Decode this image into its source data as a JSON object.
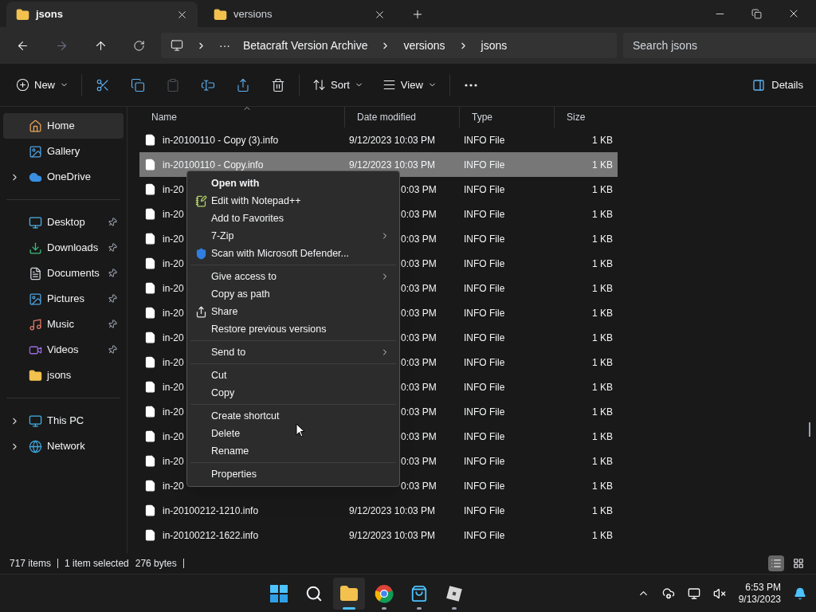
{
  "tabs": [
    {
      "label": "jsons",
      "selected": true
    },
    {
      "label": "versions",
      "selected": false
    }
  ],
  "address": {
    "more": "···",
    "crumbs": [
      "Betacraft Version Archive",
      "versions",
      "jsons"
    ]
  },
  "search": {
    "placeholder": "Search jsons"
  },
  "toolbar": {
    "buttons": [
      {
        "kind": "new",
        "label": "New",
        "disabled": false
      },
      {
        "kind": "cut",
        "disabled": false
      },
      {
        "kind": "copy",
        "disabled": false
      },
      {
        "kind": "paste",
        "disabled": true
      },
      {
        "kind": "rename",
        "disabled": false
      },
      {
        "kind": "share",
        "disabled": false
      },
      {
        "kind": "delete",
        "disabled": false
      },
      {
        "kind": "sort",
        "label": "Sort",
        "disabled": false
      },
      {
        "kind": "view",
        "label": "View",
        "disabled": false
      },
      {
        "kind": "more",
        "disabled": false
      }
    ],
    "details": "Details"
  },
  "sidebar": {
    "groups": [
      [
        {
          "kind": "home",
          "label": "Home",
          "selected": true,
          "expandable": false,
          "pinned": false
        },
        {
          "kind": "gallery",
          "label": "Gallery",
          "selected": false,
          "expandable": false,
          "pinned": false
        },
        {
          "kind": "cloud",
          "label": "OneDrive",
          "selected": false,
          "expandable": true,
          "pinned": false
        }
      ],
      [
        {
          "kind": "desktop",
          "label": "Desktop",
          "selected": false,
          "expandable": false,
          "pinned": true
        },
        {
          "kind": "downloads",
          "label": "Downloads",
          "selected": false,
          "expandable": false,
          "pinned": true
        },
        {
          "kind": "documents",
          "label": "Documents",
          "selected": false,
          "expandable": false,
          "pinned": true
        },
        {
          "kind": "pictures",
          "label": "Pictures",
          "selected": false,
          "expandable": false,
          "pinned": true
        },
        {
          "kind": "music",
          "label": "Music",
          "selected": false,
          "expandable": false,
          "pinned": true
        },
        {
          "kind": "videos",
          "label": "Videos",
          "selected": false,
          "expandable": false,
          "pinned": true
        },
        {
          "kind": "folder",
          "label": "jsons",
          "selected": false,
          "expandable": false,
          "pinned": false
        }
      ],
      [
        {
          "kind": "pc",
          "label": "This PC",
          "selected": false,
          "expandable": true,
          "pinned": false
        },
        {
          "kind": "network",
          "label": "Network",
          "selected": false,
          "expandable": true,
          "pinned": false
        }
      ]
    ]
  },
  "table": {
    "columns": [
      {
        "label": "Name",
        "sorted": true
      },
      {
        "label": "Date modified",
        "sorted": false
      },
      {
        "label": "Type",
        "sorted": false
      },
      {
        "label": "Size",
        "sorted": false
      }
    ],
    "rows": [
      {
        "name": "in-20100110 - Copy (3).info",
        "date": "9/12/2023 10:03 PM",
        "type": "INFO File",
        "size": "1 KB",
        "selected": false,
        "covered": false
      },
      {
        "name": "in-20100110 - Copy.info",
        "date": "9/12/2023 10:03 PM",
        "type": "INFO File",
        "size": "1 KB",
        "selected": true,
        "covered": false
      },
      {
        "name": "in-20",
        "date": "0:03 PM",
        "type": "INFO File",
        "size": "1 KB",
        "selected": false,
        "covered": true
      },
      {
        "name": "in-20",
        "date": "0:03 PM",
        "type": "INFO File",
        "size": "1 KB",
        "selected": false,
        "covered": true
      },
      {
        "name": "in-20",
        "date": "0:03 PM",
        "type": "INFO File",
        "size": "1 KB",
        "selected": false,
        "covered": true
      },
      {
        "name": "in-20",
        "date": "0:03 PM",
        "type": "INFO File",
        "size": "1 KB",
        "selected": false,
        "covered": true
      },
      {
        "name": "in-20",
        "date": "0:03 PM",
        "type": "INFO File",
        "size": "1 KB",
        "selected": false,
        "covered": true
      },
      {
        "name": "in-20",
        "date": "0:03 PM",
        "type": "INFO File",
        "size": "1 KB",
        "selected": false,
        "covered": true
      },
      {
        "name": "in-20",
        "date": "0:03 PM",
        "type": "INFO File",
        "size": "1 KB",
        "selected": false,
        "covered": true
      },
      {
        "name": "in-20",
        "date": "0:03 PM",
        "type": "INFO File",
        "size": "1 KB",
        "selected": false,
        "covered": true
      },
      {
        "name": "in-20",
        "date": "0:03 PM",
        "type": "INFO File",
        "size": "1 KB",
        "selected": false,
        "covered": true
      },
      {
        "name": "in-20",
        "date": "0:03 PM",
        "type": "INFO File",
        "size": "1 KB",
        "selected": false,
        "covered": true
      },
      {
        "name": "in-20",
        "date": "0:03 PM",
        "type": "INFO File",
        "size": "1 KB",
        "selected": false,
        "covered": true
      },
      {
        "name": "in-20",
        "date": "0:03 PM",
        "type": "INFO File",
        "size": "1 KB",
        "selected": false,
        "covered": true
      },
      {
        "name": "in-20",
        "date": "0:03 PM",
        "type": "INFO File",
        "size": "1 KB",
        "selected": false,
        "covered": true
      },
      {
        "name": "in-20100212-1210.info",
        "date": "9/12/2023 10:03 PM",
        "type": "INFO File",
        "size": "1 KB",
        "selected": false,
        "covered": false
      },
      {
        "name": "in-20100212-1622.info",
        "date": "9/12/2023 10:03 PM",
        "type": "INFO File",
        "size": "1 KB",
        "selected": false,
        "covered": false
      }
    ]
  },
  "context_menu": {
    "groups": [
      [
        {
          "label": "Open with",
          "bold": true,
          "submenu": false,
          "kind": "plain"
        },
        {
          "label": "Edit with Notepad++",
          "bold": false,
          "submenu": false,
          "kind": "notepad"
        },
        {
          "label": "Add to Favorites",
          "bold": false,
          "submenu": false,
          "kind": "plain"
        },
        {
          "label": "7-Zip",
          "bold": false,
          "submenu": true,
          "kind": "plain"
        },
        {
          "label": "Scan with Microsoft Defender...",
          "bold": false,
          "submenu": false,
          "kind": "shield"
        }
      ],
      [
        {
          "label": "Give access to",
          "bold": false,
          "submenu": true,
          "kind": "plain"
        },
        {
          "label": "Copy as path",
          "bold": false,
          "submenu": false,
          "kind": "plain"
        },
        {
          "label": "Share",
          "bold": false,
          "submenu": false,
          "kind": "share"
        },
        {
          "label": "Restore previous versions",
          "bold": false,
          "submenu": false,
          "kind": "plain"
        }
      ],
      [
        {
          "label": "Send to",
          "bold": false,
          "submenu": true,
          "kind": "plain"
        }
      ],
      [
        {
          "label": "Cut",
          "bold": false,
          "submenu": false,
          "kind": "plain"
        },
        {
          "label": "Copy",
          "bold": false,
          "submenu": false,
          "kind": "plain"
        }
      ],
      [
        {
          "label": "Create shortcut",
          "bold": false,
          "submenu": false,
          "kind": "plain"
        },
        {
          "label": "Delete",
          "bold": false,
          "submenu": false,
          "kind": "plain"
        },
        {
          "label": "Rename",
          "bold": false,
          "submenu": false,
          "kind": "plain"
        }
      ],
      [
        {
          "label": "Properties",
          "bold": false,
          "submenu": false,
          "kind": "plain"
        }
      ]
    ]
  },
  "status_bar": {
    "count": "717 items",
    "selection": "1 item selected",
    "size": "276 bytes",
    "views": [
      {
        "kind": "details",
        "selected": true
      },
      {
        "kind": "tiles",
        "selected": false
      }
    ]
  },
  "taskbar": {
    "apps": [
      {
        "kind": "start",
        "active": false,
        "running": false
      },
      {
        "kind": "search",
        "active": false,
        "running": false
      },
      {
        "kind": "explorer",
        "active": true,
        "running": true
      },
      {
        "kind": "chrome",
        "active": false,
        "running": true
      },
      {
        "kind": "store",
        "active": false,
        "running": true
      },
      {
        "kind": "cube",
        "active": false,
        "running": true
      }
    ],
    "time": "6:53 PM",
    "date": "9/13/2023"
  }
}
